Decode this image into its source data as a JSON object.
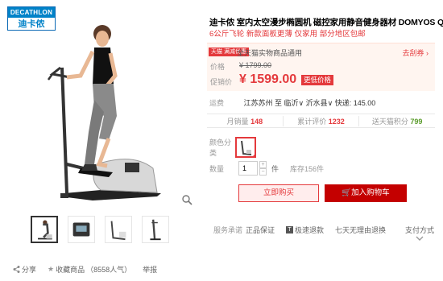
{
  "logo": {
    "top": "DECATHLON",
    "bottom": "迪卡侬"
  },
  "product": {
    "title": "迪卡侬 室内太空漫步椭圆机 磁控家用静音健身器材 DOMYOS QC",
    "subtitle": "6公斤飞轮 新款面板更薄 仅家用 部分地区包邮"
  },
  "price_box": {
    "tmall_tag": "天猫 满减优惠",
    "promo_text": "全天猫实物商品通用",
    "coupon_link": "去刮券",
    "price_label": "价格",
    "original_price": "¥ 1799.00",
    "promo_label": "促销价",
    "promo_price": "¥ 1599.00",
    "promo_badge": "更低价格"
  },
  "shipping": {
    "label": "运费",
    "text": "江苏苏州 至 临沂∨ 沂水县∨ 快递: 145.00"
  },
  "stats": [
    {
      "label": "月销量",
      "value": "148",
      "accent": "red"
    },
    {
      "label": "累计评价",
      "value": "1232",
      "accent": "red"
    },
    {
      "label": "送天猫积分",
      "value": "799",
      "accent": "green"
    }
  ],
  "options": {
    "color_label": "颜色分类",
    "qty_label": "数量",
    "qty_value": "1",
    "unit": "件",
    "stock": "库存156件"
  },
  "buttons": {
    "buy": "立即购买",
    "cart": "🛒加入购物车"
  },
  "service": {
    "label": "服务承诺",
    "items": [
      "正品保证",
      "极速退款",
      "七天无理由退换"
    ],
    "tmall_mark": "T",
    "pay": "支付方式"
  },
  "share": {
    "share": "分享",
    "favorite": "收藏商品",
    "popularity": "（8558人气）",
    "report": "举报"
  },
  "colors": {
    "accent": "#e4393c",
    "cart": "#c40000",
    "decathlon": "#0082c8"
  }
}
